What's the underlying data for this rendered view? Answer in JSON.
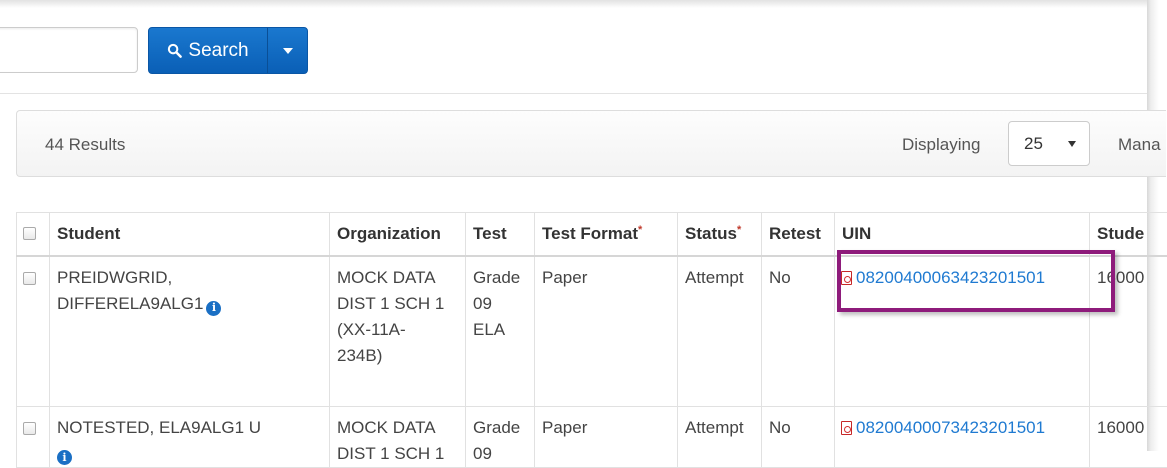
{
  "search": {
    "button_label": "Search",
    "input_value": ""
  },
  "results": {
    "count_label": "44 Results",
    "displaying_label": "Displaying",
    "page_size": "25",
    "manage_label": "Mana"
  },
  "table": {
    "headers": [
      "Student",
      "Organization",
      "Test",
      "Test Format",
      "Status",
      "Retest",
      "UIN",
      "Stude"
    ],
    "required_mark": "*",
    "rows": [
      {
        "student_line1": "PREIDWGRID,",
        "student_line2": "DIFFERELA9ALG1",
        "org_l1": "MOCK DATA",
        "org_l2": "DIST 1 SCH 1",
        "org_l3": "(XX-11A-",
        "org_l4": "234B)",
        "test_l1": "Grade",
        "test_l2": "09",
        "test_l3": "ELA",
        "format": "Paper",
        "status": "Attempt",
        "retest": "No",
        "uin": "0820040006342320150116000",
        "uin_display": "08200400063423201501",
        "student_id": "16000"
      },
      {
        "student_line1": "NOTESTED, ELA9ALG1 U",
        "student_line2": "",
        "org_l1": "MOCK DATA",
        "org_l2": "DIST 1 SCH 1",
        "org_l3": "",
        "org_l4": "",
        "test_l1": "Grade",
        "test_l2": "09",
        "test_l3": "",
        "format": "Paper",
        "status": "Attempt",
        "retest": "No",
        "uin": "08200400073423201501",
        "uin_display": "08200400073423201501",
        "student_id": "16000"
      }
    ]
  },
  "icons": {
    "search": "search-icon",
    "caret": "chevron-down-icon",
    "info": "info-icon",
    "pdf": "pdf-icon"
  }
}
